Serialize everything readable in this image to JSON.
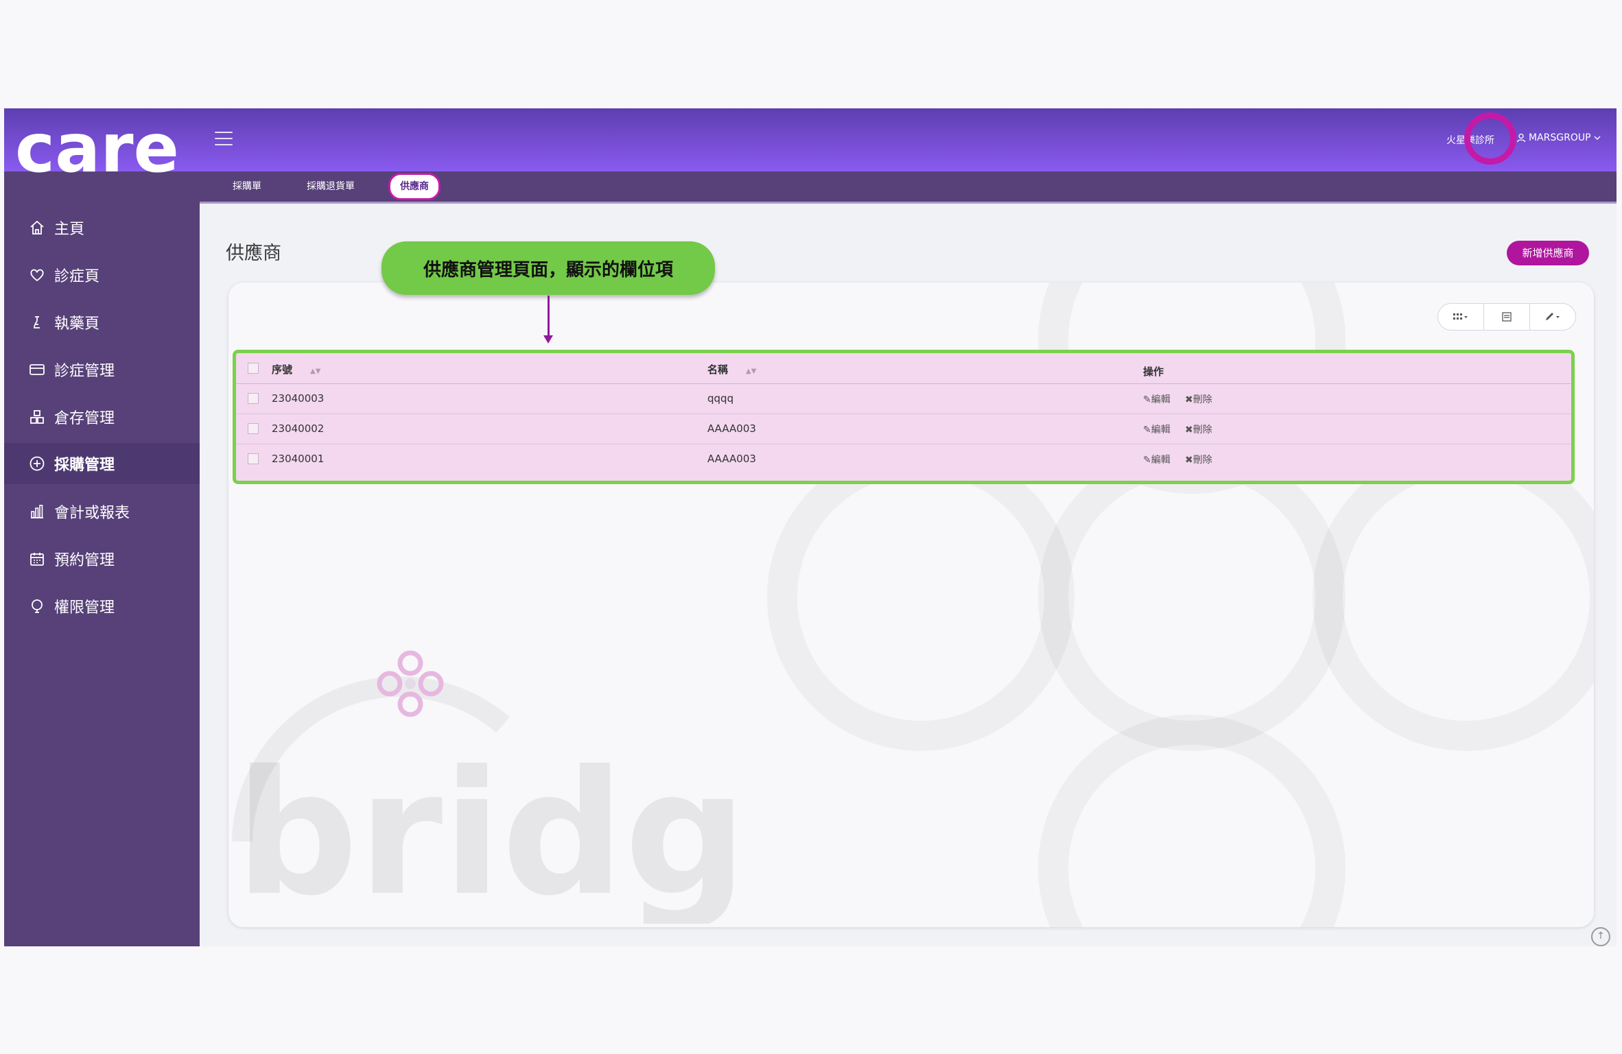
{
  "header": {
    "logo_text": "care",
    "clinic_name": "火星樂診所",
    "user_name": "MARSGROUP"
  },
  "sidebar": {
    "items": [
      {
        "label": "主頁",
        "icon": "home-icon"
      },
      {
        "label": "診症頁",
        "icon": "heart-icon"
      },
      {
        "label": "執藥頁",
        "icon": "pharmacy-icon"
      },
      {
        "label": "診症管理",
        "icon": "card-icon"
      },
      {
        "label": "倉存管理",
        "icon": "inventory-icon"
      },
      {
        "label": "採購管理",
        "icon": "plus-circle-icon",
        "active": true
      },
      {
        "label": "會計或報表",
        "icon": "bar-chart-icon"
      },
      {
        "label": "預約管理",
        "icon": "calendar-icon"
      },
      {
        "label": "權限管理",
        "icon": "permission-icon"
      }
    ]
  },
  "tabs": [
    {
      "label": "採購單"
    },
    {
      "label": "採購退貨單"
    },
    {
      "label": "供應商",
      "active": true
    }
  ],
  "page": {
    "title": "供應商",
    "add_button": "新增供應商"
  },
  "callout": {
    "text": "供應商管理頁面，顯示的欄位項"
  },
  "table": {
    "columns": [
      "序號",
      "名稱",
      "操作"
    ],
    "rows": [
      {
        "id": "23040003",
        "name": "qqqq"
      },
      {
        "id": "23040002",
        "name": "AAAA003"
      },
      {
        "id": "23040001",
        "name": "AAAA003"
      }
    ],
    "edit_label": "編輯",
    "delete_label": "刪除"
  },
  "watermark": {
    "text": "bridge"
  },
  "colors": {
    "header_top": "#5d3fb0",
    "header_bottom": "#8a5af0",
    "sidebar": "#574178",
    "accent": "#b0159e",
    "callout": "#73c948",
    "table_highlight": "#f3d8ef"
  }
}
